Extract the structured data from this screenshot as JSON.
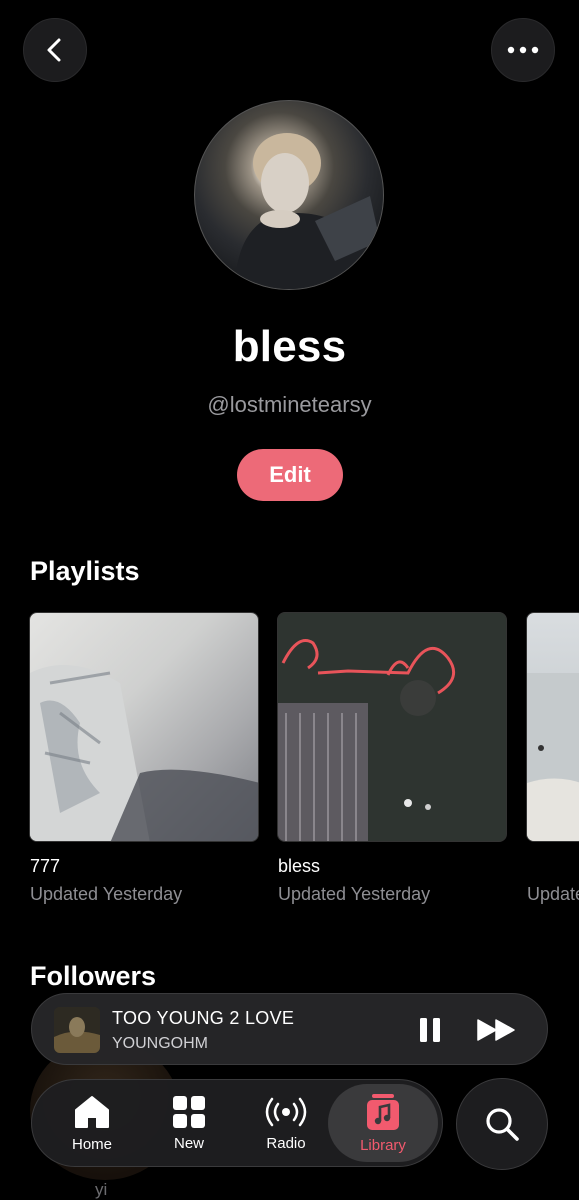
{
  "header": {
    "back_icon": "chevron-left-icon",
    "more_icon": "ellipsis-icon"
  },
  "profile": {
    "name": "bless",
    "handle": "@lostminetearsy",
    "edit_label": "Edit"
  },
  "playlists": {
    "title": "Playlists",
    "items": [
      {
        "title": "777",
        "subtitle": "Updated Yesterday"
      },
      {
        "title": "bless",
        "subtitle": "Updated Yesterday"
      },
      {
        "title": "",
        "subtitle": "Updated Yesterday"
      }
    ]
  },
  "followers": {
    "title": "Followers",
    "first_name": "yi"
  },
  "now_playing": {
    "title": "TOO YOUNG 2 LOVE",
    "artist": "YOUNGOHM"
  },
  "tabs": [
    {
      "label": "Home",
      "icon": "house-icon"
    },
    {
      "label": "New",
      "icon": "grid-icon"
    },
    {
      "label": "Radio",
      "icon": "radio-waves-icon"
    },
    {
      "label": "Library",
      "icon": "music-note-icon"
    }
  ],
  "colors": {
    "accent": "#ed6a78",
    "active_tab": "#f25a6e",
    "secondary_text": "#8e8e93"
  }
}
